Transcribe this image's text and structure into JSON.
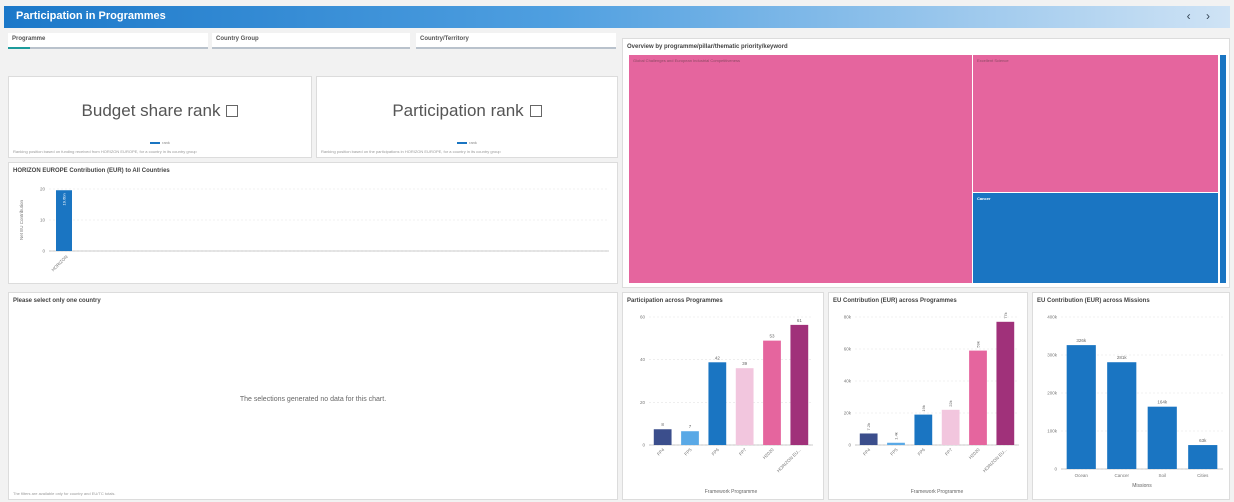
{
  "header": {
    "title": "Participation in Programmes",
    "prev": "‹",
    "next": "›"
  },
  "filters": [
    {
      "label": "Programme"
    },
    {
      "label": "Country Group"
    },
    {
      "label": "Country/Territory"
    }
  ],
  "budget_rank": {
    "title": "Budget share rank",
    "legend": "rank",
    "note": "Ranking position based on funding received from HORIZON EUROPE, for a country in its country group"
  },
  "participation_rank": {
    "title": "Participation rank",
    "legend": "rank",
    "note": "Ranking position based on the participations in HORIZON EUROPE, for a country in its country group"
  },
  "contribution_chart": {
    "title": "HORIZON EUROPE Contribution (EUR) to All Countries",
    "chart_data": {
      "type": "bar",
      "categories": [
        "HORIZON"
      ],
      "values": [
        19.6
      ],
      "data_labels": [
        "19.6bn"
      ],
      "ylabel": "Net EU Contribution",
      "yticks": [
        "0",
        "10",
        "20"
      ],
      "ylim": [
        0,
        20
      ]
    }
  },
  "country_panel": {
    "title": "Please select only one country",
    "message": "The selections generated no data for this chart.",
    "note": "The filters are available only for country and EU/TC totals."
  },
  "treemap": {
    "title": "Overview by programme/pillar/thematic priority/keyword",
    "cells": [
      {
        "label": "Global Challenges and European Industrial Competitiveness",
        "value": "",
        "color": "#e5659e"
      },
      {
        "label": "Excellent Science",
        "value": "",
        "color": "#e5659e"
      },
      {
        "label": "Cancer",
        "value": "",
        "color": "#1a75c2"
      }
    ]
  },
  "participation_programmes": {
    "title": "Participation across Programmes",
    "xlabel": "Framework Programme",
    "chart_data": {
      "type": "bar",
      "categories": [
        "FP4",
        "FP5",
        "FP6",
        "FP7",
        "H2020",
        "HORIZON EU..."
      ],
      "values": [
        8,
        7,
        42,
        39,
        53,
        61
      ],
      "data_labels": [
        "8",
        "7",
        "42",
        "39",
        "53",
        "61"
      ],
      "colors": [
        "#3b4e8c",
        "#5aa9e6",
        "#1a75c2",
        "#f2c6de",
        "#e5659e",
        "#a0317a"
      ],
      "yticks": [
        "0",
        "20",
        "40",
        "60"
      ],
      "ylim": [
        0,
        65
      ]
    }
  },
  "contribution_programmes": {
    "title": "EU Contribution (EUR) across Programmes",
    "xlabel": "Framework Programme",
    "chart_data": {
      "type": "bar",
      "categories": [
        "FP4",
        "FP5",
        "FP6",
        "FP7",
        "H2020",
        "HORIZON EU..."
      ],
      "values": [
        7.2,
        1.4,
        19,
        22,
        59,
        77
      ],
      "data_labels": [
        "7.2k",
        "1.4k",
        "19k",
        "22k",
        "59k",
        "77k"
      ],
      "colors": [
        "#3b4e8c",
        "#5aa9e6",
        "#1a75c2",
        "#f2c6de",
        "#e5659e",
        "#a0317a"
      ],
      "yticks": [
        "0",
        "20k",
        "40k",
        "60k",
        "80k"
      ],
      "ylim": [
        0,
        80
      ]
    }
  },
  "contribution_missions": {
    "title": "EU Contribution (EUR) across Missions",
    "xlabel": "Missions",
    "chart_data": {
      "type": "bar",
      "categories": [
        "Ocean",
        "Cancer",
        "Soil",
        "Cities"
      ],
      "values": [
        326,
        281,
        164,
        63
      ],
      "data_labels": [
        "326k",
        "281k",
        "164k",
        "63k"
      ],
      "colors": [
        "#1a75c2",
        "#1a75c2",
        "#1a75c2",
        "#1a75c2"
      ],
      "yticks": [
        "0",
        "100k",
        "200k",
        "300k",
        "400k"
      ],
      "ylim": [
        0,
        400
      ]
    }
  }
}
